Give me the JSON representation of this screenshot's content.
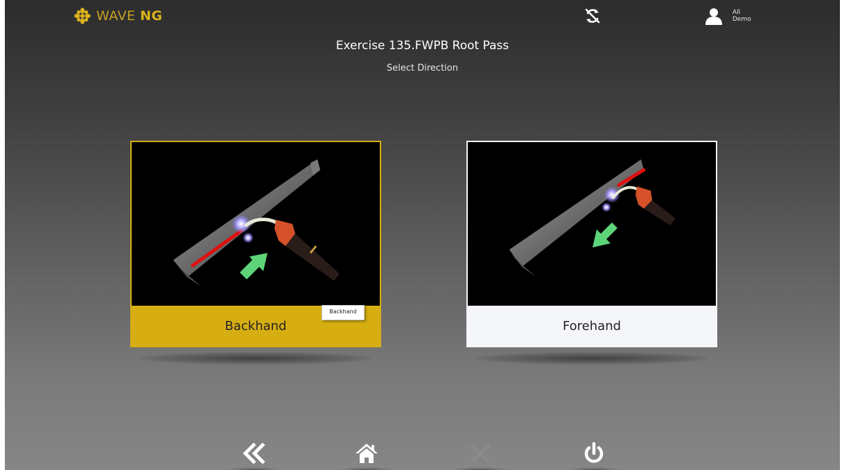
{
  "header": {
    "logo_wave": "WAVE",
    "logo_ng": "NG",
    "user_line1": "All",
    "user_line2": "Demo",
    "sync_icon": "sync-disabled-icon",
    "user_icon": "user-icon"
  },
  "page": {
    "title": "Exercise 135.FWPB Root Pass",
    "subtitle": "Select Direction"
  },
  "options": [
    {
      "label": "Backhand",
      "selected": true
    },
    {
      "label": "Forehand",
      "selected": false
    }
  ],
  "tooltip": {
    "text": "Backhand"
  },
  "nav": [
    {
      "icon": "double-chevron-left-icon"
    },
    {
      "icon": "home-icon"
    },
    {
      "icon": "tools-icon",
      "disabled": true
    },
    {
      "icon": "power-icon"
    }
  ],
  "colors": {
    "accent": "#d7ae12",
    "card_plain": "#f4f6f9",
    "logo": "#c9a227"
  }
}
